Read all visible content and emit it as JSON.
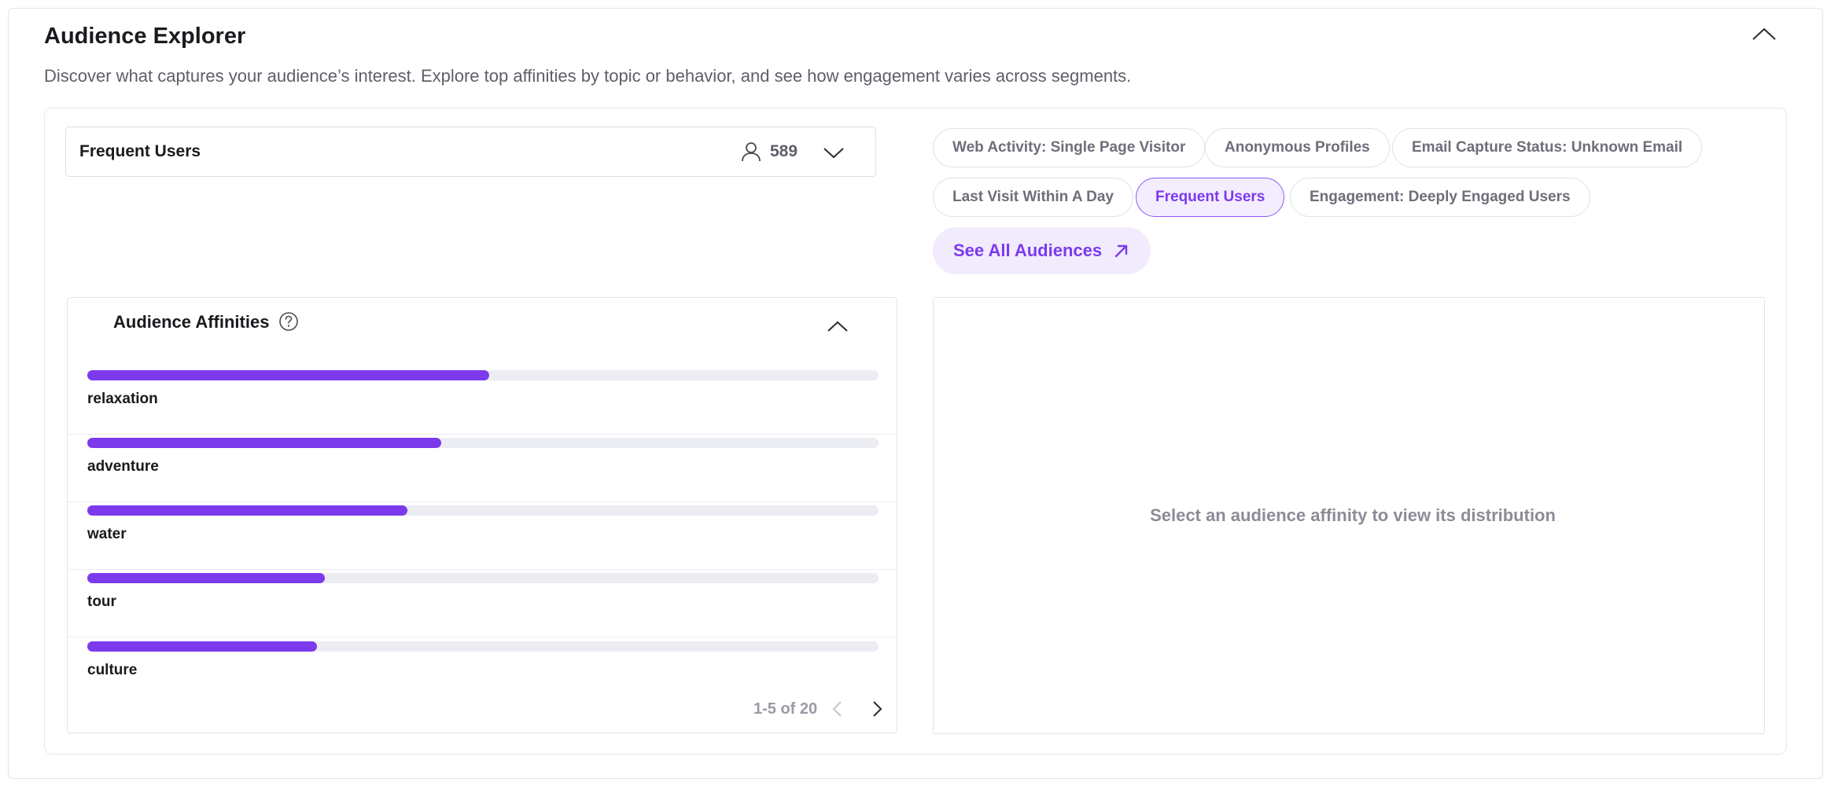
{
  "header": {
    "title": "Audience Explorer",
    "subtitle": "Discover what captures your audience’s interest. Explore top affinities by topic or behavior, and see how engagement varies across segments.",
    "collapse_icon": "chevron-up-icon"
  },
  "selector": {
    "label": "Frequent Users",
    "count": "589",
    "user_icon": "user-icon",
    "dropdown_icon": "chevron-down-icon"
  },
  "audience_chips": [
    {
      "label": "Web Activity: Single Page Visitor",
      "active": false
    },
    {
      "label": "Anonymous Profiles",
      "active": false
    },
    {
      "label": "Email Capture Status: Unknown Email",
      "active": false
    },
    {
      "label": "Last Visit Within A Day",
      "active": false
    },
    {
      "label": "Frequent Users",
      "active": true
    },
    {
      "label": "Engagement: Deeply Engaged Users",
      "active": false
    }
  ],
  "see_all": {
    "label": "See All Audiences",
    "icon": "arrow-up-right-icon"
  },
  "affinities": {
    "title": "Audience Affinities",
    "help_icon": "help-circle-icon",
    "collapse_icon": "chevron-up-icon",
    "items": [
      {
        "label": "relaxation",
        "value": 0.508
      },
      {
        "label": "adventure",
        "value": 0.447
      },
      {
        "label": "water",
        "value": 0.405
      },
      {
        "label": "tour",
        "value": 0.3
      },
      {
        "label": "culture",
        "value": 0.29
      }
    ],
    "pagination": {
      "text": "1-5 of 20",
      "prev_icon": "chevron-left-icon",
      "next_icon": "chevron-right-icon"
    }
  },
  "distribution": {
    "empty_message": "Select an audience affinity to view its distribution"
  },
  "colors": {
    "accent": "#7c3aed",
    "accent_light": "#f1ebfd",
    "track": "#ececf3",
    "muted_text": "#8c8c98"
  }
}
